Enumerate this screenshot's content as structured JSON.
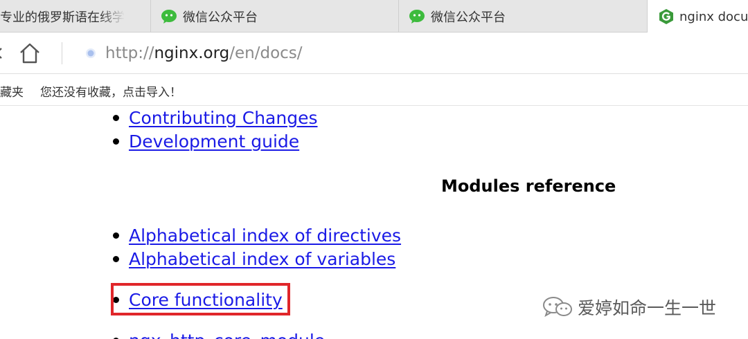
{
  "tabs": [
    {
      "label": "专业的俄罗斯语在线学",
      "icon": "none",
      "active": false
    },
    {
      "label": "微信公众平台",
      "icon": "wechat-icon",
      "active": false
    },
    {
      "label": "微信公众平台",
      "icon": "wechat-icon",
      "active": false
    },
    {
      "label": "nginx docu",
      "icon": "nginx-icon",
      "active": true
    }
  ],
  "address_bar": {
    "url_scheme": "http://",
    "url_host": "nginx.org",
    "url_path": "/en/docs/"
  },
  "bookmarks_bar": {
    "folder_label": "藏夹",
    "empty_hint": "您还没有收藏，点击导入！"
  },
  "page": {
    "links_top": [
      {
        "label": "Contributing Changes"
      },
      {
        "label": "Development guide"
      }
    ],
    "section_title": "Modules reference",
    "links_index": [
      {
        "label": "Alphabetical index of directives"
      },
      {
        "label": "Alphabetical index of variables"
      }
    ],
    "highlighted_link": {
      "label": "Core functionality"
    },
    "next_link_partial": {
      "label": "ngx_http_core_module"
    }
  },
  "watermark": {
    "text": "爱婷如命一生一世",
    "icon": "wechat-watermark-icon"
  },
  "colors": {
    "link": "#1a1ae6",
    "highlight_box": "#e0262a",
    "wechat_green": "#3dbb3d",
    "nginx_green": "#3a9a3a",
    "tab_bar": "#e6e6e6"
  }
}
